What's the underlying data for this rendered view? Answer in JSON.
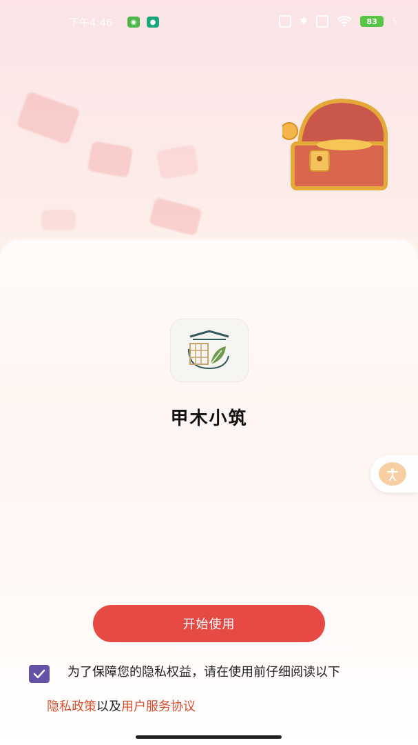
{
  "status_bar": {
    "time": "下午4:46",
    "battery": "83"
  },
  "app": {
    "name": "甲木小筑"
  },
  "start_button": {
    "label": "开始使用"
  },
  "consent": {
    "checked": true,
    "text": "为了保障您的隐私权益，请在使用前仔细阅读以下",
    "privacy_link": "隐私政策",
    "connector": "以及",
    "terms_link": "用户服务协议"
  },
  "colors": {
    "primary": "#e64a45",
    "link": "#d9502f",
    "checkbox": "#6552a6"
  }
}
